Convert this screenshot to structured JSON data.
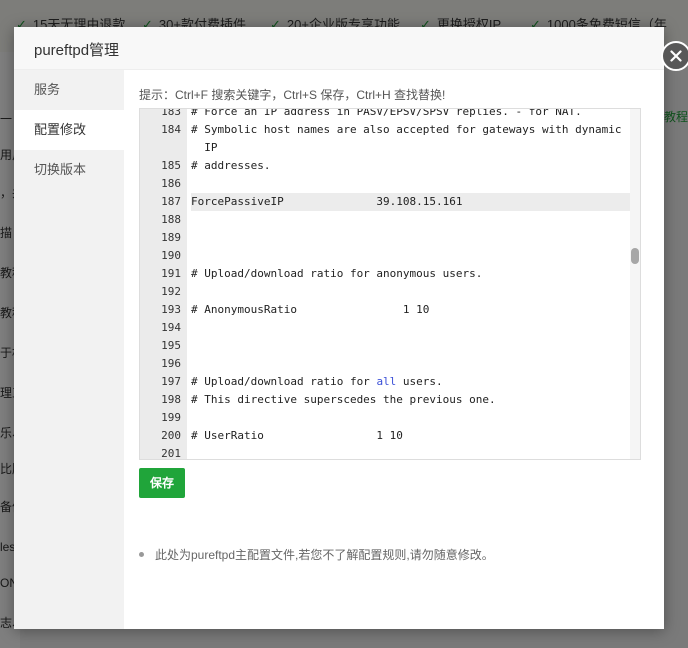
{
  "background": {
    "features": [
      "15天无理由退款",
      "30+款付费插件",
      "20+企业版专享功能",
      "更换授权IP",
      "1000条免费短信（年"
    ],
    "left_fragments": [
      "一",
      "用户",
      "，并",
      "描",
      "教程",
      "教程",
      "于相",
      "理工",
      "乐、",
      "比版",
      "备份",
      "les",
      "ON",
      "志、"
    ],
    "right_link": "+教程"
  },
  "modal": {
    "title": "pureftpd管理",
    "close_icon": "close-icon",
    "tabs": [
      {
        "label": "服务",
        "active": false
      },
      {
        "label": "配置修改",
        "active": true
      },
      {
        "label": "切换版本",
        "active": false
      }
    ],
    "hint": "提示：Ctrl+F 搜索关键字，Ctrl+S 保存，Ctrl+H 查找替换!",
    "editor": {
      "lines": [
        {
          "n": "183",
          "t": "# Force an IP address in PASV/EPSV/SPSV replies. - for NAT."
        },
        {
          "n": "184",
          "t": "# Symbolic host names are also accepted for gateways with dynamic"
        },
        {
          "n": "",
          "t": "  IP"
        },
        {
          "n": "185",
          "t": "# addresses."
        },
        {
          "n": "186",
          "t": ""
        },
        {
          "n": "187",
          "t": "ForcePassiveIP              39.108.15.161"
        },
        {
          "n": "188",
          "t": ""
        },
        {
          "n": "189",
          "t": ""
        },
        {
          "n": "190",
          "t": ""
        },
        {
          "n": "191",
          "t": "# Upload/download ratio for anonymous users."
        },
        {
          "n": "192",
          "t": ""
        },
        {
          "n": "193",
          "t": "# AnonymousRatio                1 10"
        },
        {
          "n": "194",
          "t": ""
        },
        {
          "n": "195",
          "t": ""
        },
        {
          "n": "196",
          "t": ""
        },
        {
          "n": "197",
          "t": "# Upload/download ratio for all users."
        },
        {
          "n": "198",
          "t": "# This directive superscedes the previous one."
        },
        {
          "n": "199",
          "t": ""
        },
        {
          "n": "200",
          "t": "# UserRatio                 1 10"
        },
        {
          "n": "201",
          "t": ""
        }
      ],
      "highlight_line": "187",
      "keyword": "all"
    },
    "save_label": "保存",
    "note": "此处为pureftpd主配置文件,若您不了解配置规则,请勿随意修改。"
  },
  "colors": {
    "accent": "#20a53a",
    "keyword": "#3a4fd7",
    "close_bg": "#585858"
  }
}
